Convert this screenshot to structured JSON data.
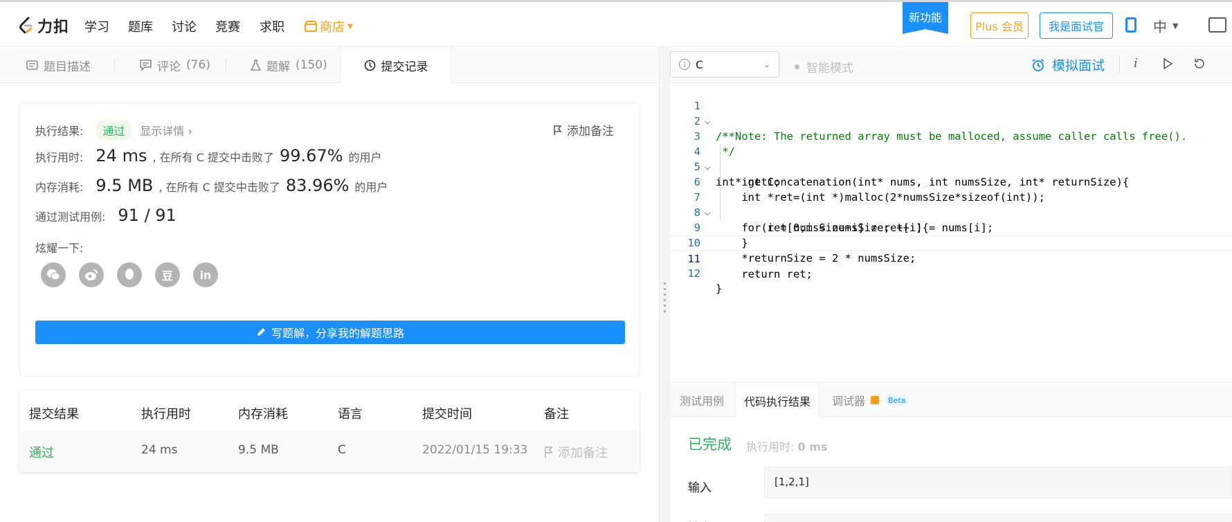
{
  "nav": {
    "logo_text": "力扣",
    "items": [
      "学习",
      "题库",
      "讨论",
      "竞赛",
      "求职"
    ],
    "shop": "商店",
    "new_feature": "新功能",
    "plus": "Plus 会员",
    "interviewer": "我是面试官",
    "lang": "中"
  },
  "tabs": [
    {
      "label": "题目描述",
      "count": ""
    },
    {
      "label": "评论",
      "count": "(76)"
    },
    {
      "label": "题解",
      "count": "(150)"
    },
    {
      "label": "提交记录",
      "count": ""
    }
  ],
  "result": {
    "status_label": "执行结果:",
    "status": "通过",
    "detail_link": "显示详情 ›",
    "add_note": "添加备注",
    "time_label": "执行用时:",
    "time_value": "24 ms",
    "time_text": ", 在所有 C 提交中击败了",
    "time_pct": "99.67%",
    "users": "的用户",
    "mem_label": "内存消耗:",
    "mem_value": "9.5 MB",
    "mem_text": ", 在所有 C 提交中击败了",
    "mem_pct": "83.96%",
    "tests_label": "通过测试用例:",
    "tests_value": "91 / 91",
    "share_label": "炫耀一下:",
    "share_icons": [
      "wechat-icon",
      "weibo-icon",
      "qq-icon",
      "douban-icon",
      "linkedin-icon"
    ],
    "douban_glyph": "豆",
    "linkedin_glyph": "in",
    "write_solution": "写题解，分享我的解题思路"
  },
  "submissions": {
    "headers": [
      "提交结果",
      "执行用时",
      "内存消耗",
      "语言",
      "提交时间",
      "备注"
    ],
    "rows": [
      {
        "result": "通过",
        "time": "24 ms",
        "memory": "9.5 MB",
        "lang": "C",
        "submitted": "2022/01/15 19:33",
        "note": "添加备注"
      }
    ]
  },
  "editor_toolbar": {
    "language": "C",
    "smart_mode": "智能模式",
    "mock_interview": "模拟面试"
  },
  "code_lines": [
    "/**",
    " * Note: The returned array must be malloced, assume caller calls free().",
    " */",
    "int* getConcatenation(int* nums, int numsSize, int* returnSize){",
    "    int i;",
    "    int *ret=(int *)malloc(2*numsSize*sizeof(int));",
    "    for(i = 0;i < numsSize; ++i){",
    "        ret[numsSize+i] = ret[i] = nums[i];",
    "    }",
    "    *returnSize = 2 * numsSize;",
    "    return ret;",
    "}"
  ],
  "console": {
    "tabs": [
      "测试用例",
      "代码执行结果",
      "调试器"
    ],
    "beta": "Beta",
    "status": "已完成",
    "run_time_label": "执行用时:",
    "run_time_value": "0 ms",
    "input_label": "输入",
    "input_value": "[1,2,1]",
    "output_label": "输出"
  },
  "colors": {
    "accent": "#1a90ff",
    "success": "#2db55d",
    "brand_orange": "#ffa116"
  }
}
